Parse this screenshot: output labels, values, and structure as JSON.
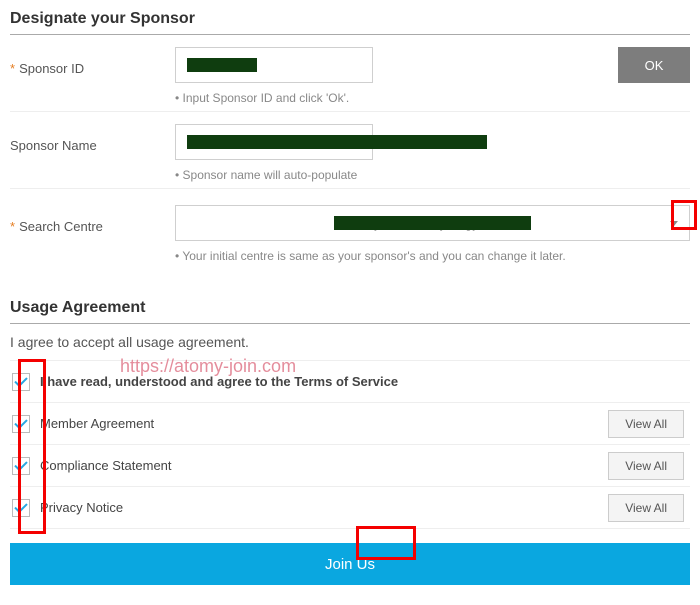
{
  "section1_title": "Designate your Sponsor",
  "sponsor_id": {
    "label": "Sponsor ID",
    "ok_label": "OK",
    "hint": "• Input Sponsor ID and click 'Ok'."
  },
  "sponsor_name": {
    "label": "Sponsor Name",
    "hint": "• Sponsor name will auto-populate"
  },
  "search_centre": {
    "label": "Search Centre",
    "selected": "Atomy London Synergy Centre",
    "hint": "• Your initial centre is same as your sponsor's and you can change it later."
  },
  "section2_title": "Usage Agreement",
  "agree_intro": "I agree to accept all usage agreement.",
  "items": [
    {
      "label": "I have read, understood and agree to the Terms of Service",
      "view": false
    },
    {
      "label": "Member Agreement",
      "view": true
    },
    {
      "label": "Compliance Statement",
      "view": true
    },
    {
      "label": "Privacy Notice",
      "view": true
    }
  ],
  "view_all_label": "View All",
  "join_label": "Join Us",
  "watermark": "https://atomy-join.com"
}
